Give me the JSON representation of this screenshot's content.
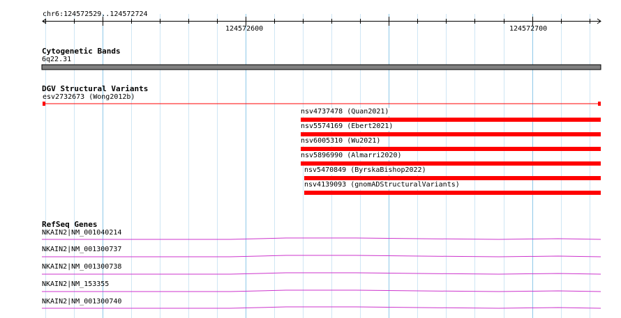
{
  "ruler": {
    "region": "chr6:124572529..124572724",
    "start": 124572529,
    "end": 124572724,
    "major_ticks": [
      "124572600",
      "124572700"
    ]
  },
  "tracks": {
    "cytoband": {
      "title": "Cytogenetic Bands",
      "band_label": "6q22.31",
      "color": "#808080"
    },
    "dgv": {
      "title": "DGV Structural Variants",
      "color": "#ff0000",
      "variants": [
        {
          "label": "esv2732673 (Wong2012b)",
          "start": 124572529,
          "end": 124572724,
          "style": "thin-endcaps"
        },
        {
          "label": "nsv4737478 (Quan2021)",
          "start": 124572620,
          "end": 124572724,
          "style": "thick"
        },
        {
          "label": "nsv5574169 (Ebert2021)",
          "start": 124572620,
          "end": 124572724,
          "style": "thick"
        },
        {
          "label": "nsv6005310 (Wu2021)",
          "start": 124572620,
          "end": 124572724,
          "style": "thick"
        },
        {
          "label": "nsv5896990 (Almarri2020)",
          "start": 124572620,
          "end": 124572724,
          "style": "thick"
        },
        {
          "label": "nsv5470849 (ByrskaBishop2022)",
          "start": 124572621,
          "end": 124572724,
          "style": "thick"
        },
        {
          "label": "nsv4139093 (gnomADStructuralVariants)",
          "start": 124572621,
          "end": 124572724,
          "style": "thick"
        }
      ]
    },
    "refseq": {
      "title": "RefSeq Genes",
      "color": "#cc33cc",
      "transcripts": [
        "NKAIN2|NM_001040214",
        "NKAIN2|NM_001300737",
        "NKAIN2|NM_001300738",
        "NKAIN2|NM_153355",
        "NKAIN2|NM_001300740"
      ]
    }
  },
  "colors": {
    "grid_major": "#8ec8e8",
    "grid_minor": "#cfe6f4",
    "ruler": "#000000"
  }
}
